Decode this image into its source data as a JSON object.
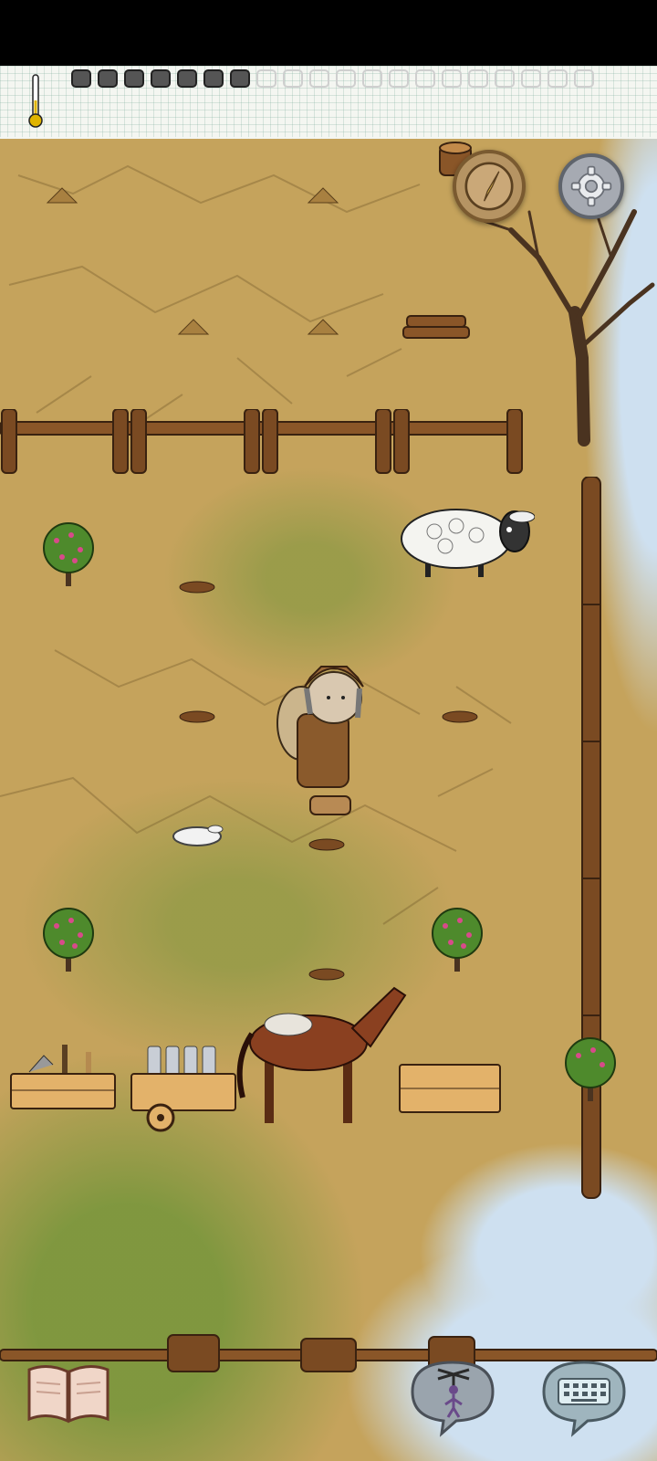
{
  "hud": {
    "temperature_icon": "thermometer-icon",
    "food_pips_filled": 7,
    "food_pips_total": 20
  },
  "controls": {
    "compass_icon": "compass-icon",
    "settings_icon": "gear-icon",
    "book_icon": "open-book-icon",
    "puppet_icon": "puppet-emote-icon",
    "keyboard_icon": "keyboard-icon"
  },
  "scene": {
    "player": "player-character-fur-hat",
    "animals": [
      "sheep",
      "horse-with-cart",
      "rabbit"
    ],
    "objects": [
      "wooden-fence",
      "dead-tree",
      "firewood-pile",
      "gooseberry-bush",
      "wooden-crate-with-tools",
      "wooden-crate-empty",
      "cart-with-bottles"
    ]
  },
  "colors": {
    "ground": "#c5a35c",
    "grass": "#789640",
    "snow": "#cee0f0",
    "fence": "#7a4a22",
    "hud_paper": "#f4f6f1"
  }
}
